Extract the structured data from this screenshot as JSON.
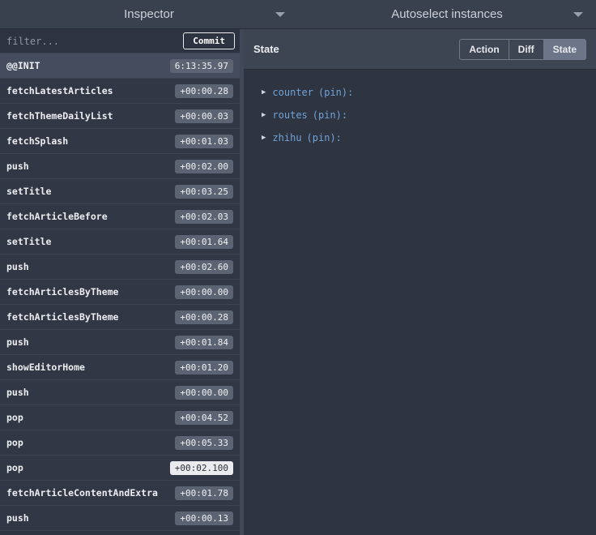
{
  "header": {
    "left_dropdown": "Inspector",
    "right_dropdown": "Autoselect instances"
  },
  "action_list": {
    "filter_placeholder": "filter...",
    "commit_label": "Commit",
    "items": [
      {
        "name": "@@INIT",
        "time": "6:13:35.97"
      },
      {
        "name": "fetchLatestArticles",
        "time": "+00:00.28"
      },
      {
        "name": "fetchThemeDailyList",
        "time": "+00:00.03"
      },
      {
        "name": "fetchSplash",
        "time": "+00:01.03"
      },
      {
        "name": "push",
        "time": "+00:02.00"
      },
      {
        "name": "setTitle",
        "time": "+00:03.25"
      },
      {
        "name": "fetchArticleBefore",
        "time": "+00:02.03"
      },
      {
        "name": "setTitle",
        "time": "+00:01.64"
      },
      {
        "name": "push",
        "time": "+00:02.60"
      },
      {
        "name": "fetchArticlesByTheme",
        "time": "+00:00.00"
      },
      {
        "name": "fetchArticlesByTheme",
        "time": "+00:00.28"
      },
      {
        "name": "push",
        "time": "+00:01.84"
      },
      {
        "name": "showEditorHome",
        "time": "+00:01.20"
      },
      {
        "name": "push",
        "time": "+00:00.00"
      },
      {
        "name": "pop",
        "time": "+00:04.52"
      },
      {
        "name": "pop",
        "time": "+00:05.33"
      },
      {
        "name": "pop",
        "time": "+00:02.100"
      },
      {
        "name": "fetchArticleContentAndExtra",
        "time": "+00:01.78"
      },
      {
        "name": "push",
        "time": "+00:00.13"
      }
    ]
  },
  "state_panel": {
    "title": "State",
    "tabs": [
      {
        "label": "Action"
      },
      {
        "label": "Diff"
      },
      {
        "label": "State"
      }
    ],
    "tree": [
      {
        "key": "counter",
        "meta": "(pin):"
      },
      {
        "key": "routes",
        "meta": "(pin):"
      },
      {
        "key": "zhihu",
        "meta": "(pin):"
      }
    ]
  },
  "colors": {
    "topbar_bg": "#3a414e",
    "panel_bg": "#2e3440",
    "row_bg": "#313744",
    "selected_row_bg": "#454c5d",
    "badge_bg": "#5c6372",
    "active_tab_bg": "#6d7689",
    "tree_key": "#72a3d9"
  }
}
